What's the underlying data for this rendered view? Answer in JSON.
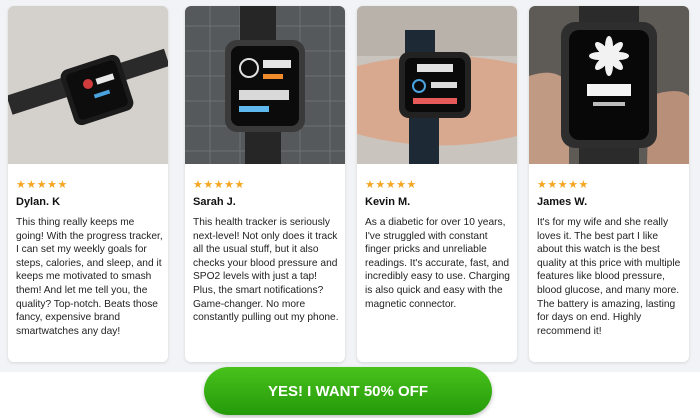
{
  "reviews": [
    {
      "stars": "★★★★★",
      "name": "Dylan. K",
      "text": "This thing really keeps me going! With the progress tracker, I can set my weekly goals for steps, calories, and sleep, and it keeps me motivated to smash them! And let me tell you, the quality? Top-notch. Beats those fancy, expensive brand smartwatches any day!"
    },
    {
      "stars": "★★★★★",
      "name": "Sarah J.",
      "text": "This health tracker is seriously next-level! Not only does it track all the usual stuff, but it also checks your blood pressure and SPO2 levels with just a tap! Plus, the smart notifications? Game-changer. No more constantly pulling out my phone."
    },
    {
      "stars": "★★★★★",
      "name": "Kevin M.",
      "text": "As a diabetic for over 10 years, I've struggled with constant finger pricks and unreliable readings. It's accurate, fast, and incredibly easy to use. Charging is also quick and easy with the magnetic connector."
    },
    {
      "stars": "★★★★★",
      "name": "James W.",
      "text": "It's for my wife and she really loves it. The best part I like about this watch is the best quality at this price with multiple features like blood pressure, blood glucose, and many more. The battery is amazing, lasting for days on end. Highly recommend it!"
    }
  ],
  "cta": {
    "label": "YES! I WANT 50% OFF"
  },
  "colors": {
    "star": "#f5a623",
    "cta": "#36b014",
    "background": "#f1f3f6"
  }
}
